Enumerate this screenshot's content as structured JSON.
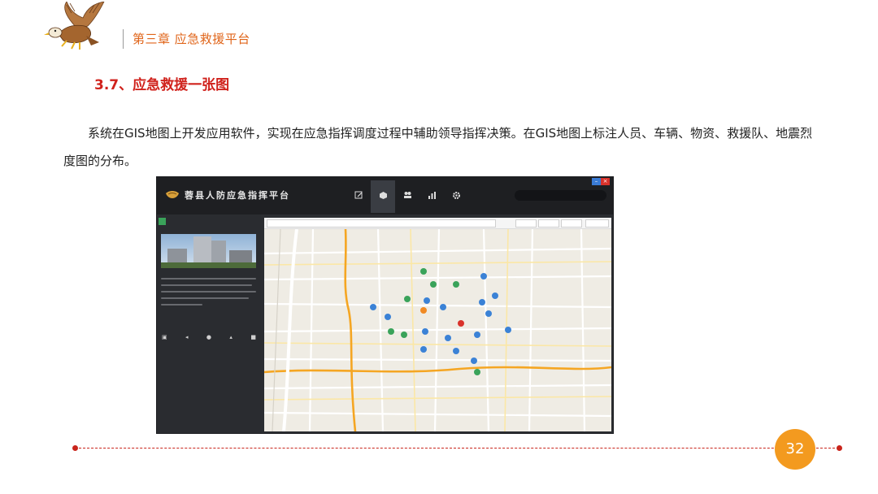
{
  "header": {
    "chapter": "第三章 应急救援平台"
  },
  "section": {
    "title": "3.7、应急救援一张图"
  },
  "body": {
    "paragraph": "系统在GIS地图上开发应用软件，实现在应急指挥调度过程中辅助领导指挥决策。在GIS地图上标注人员、车辆、物资、救援队、地震烈度图的分布。"
  },
  "app_screenshot": {
    "title": "蓉县人防应急指挥平台",
    "colors": {
      "topbar": "#1e1f22",
      "sidebar": "#2a2c30",
      "close_button": "#d9322b",
      "minimize_button": "#3a7bd5",
      "map_road_major": "#f5a623",
      "marker_blue": "#3b82d6",
      "marker_green": "#3aa35a",
      "marker_orange": "#f08a24",
      "marker_red": "#d9322b"
    },
    "tool_icons": [
      "edit-icon",
      "cube-icon",
      "users-icon",
      "chart-icon",
      "gear-icon"
    ],
    "sidebar_action_icons": [
      "camera-icon",
      "volume-icon",
      "bulb-icon",
      "upload-icon",
      "video-icon"
    ]
  },
  "footer": {
    "page_number": "32",
    "accent_color": "#c9241b",
    "badge_color": "#f39a1f"
  }
}
